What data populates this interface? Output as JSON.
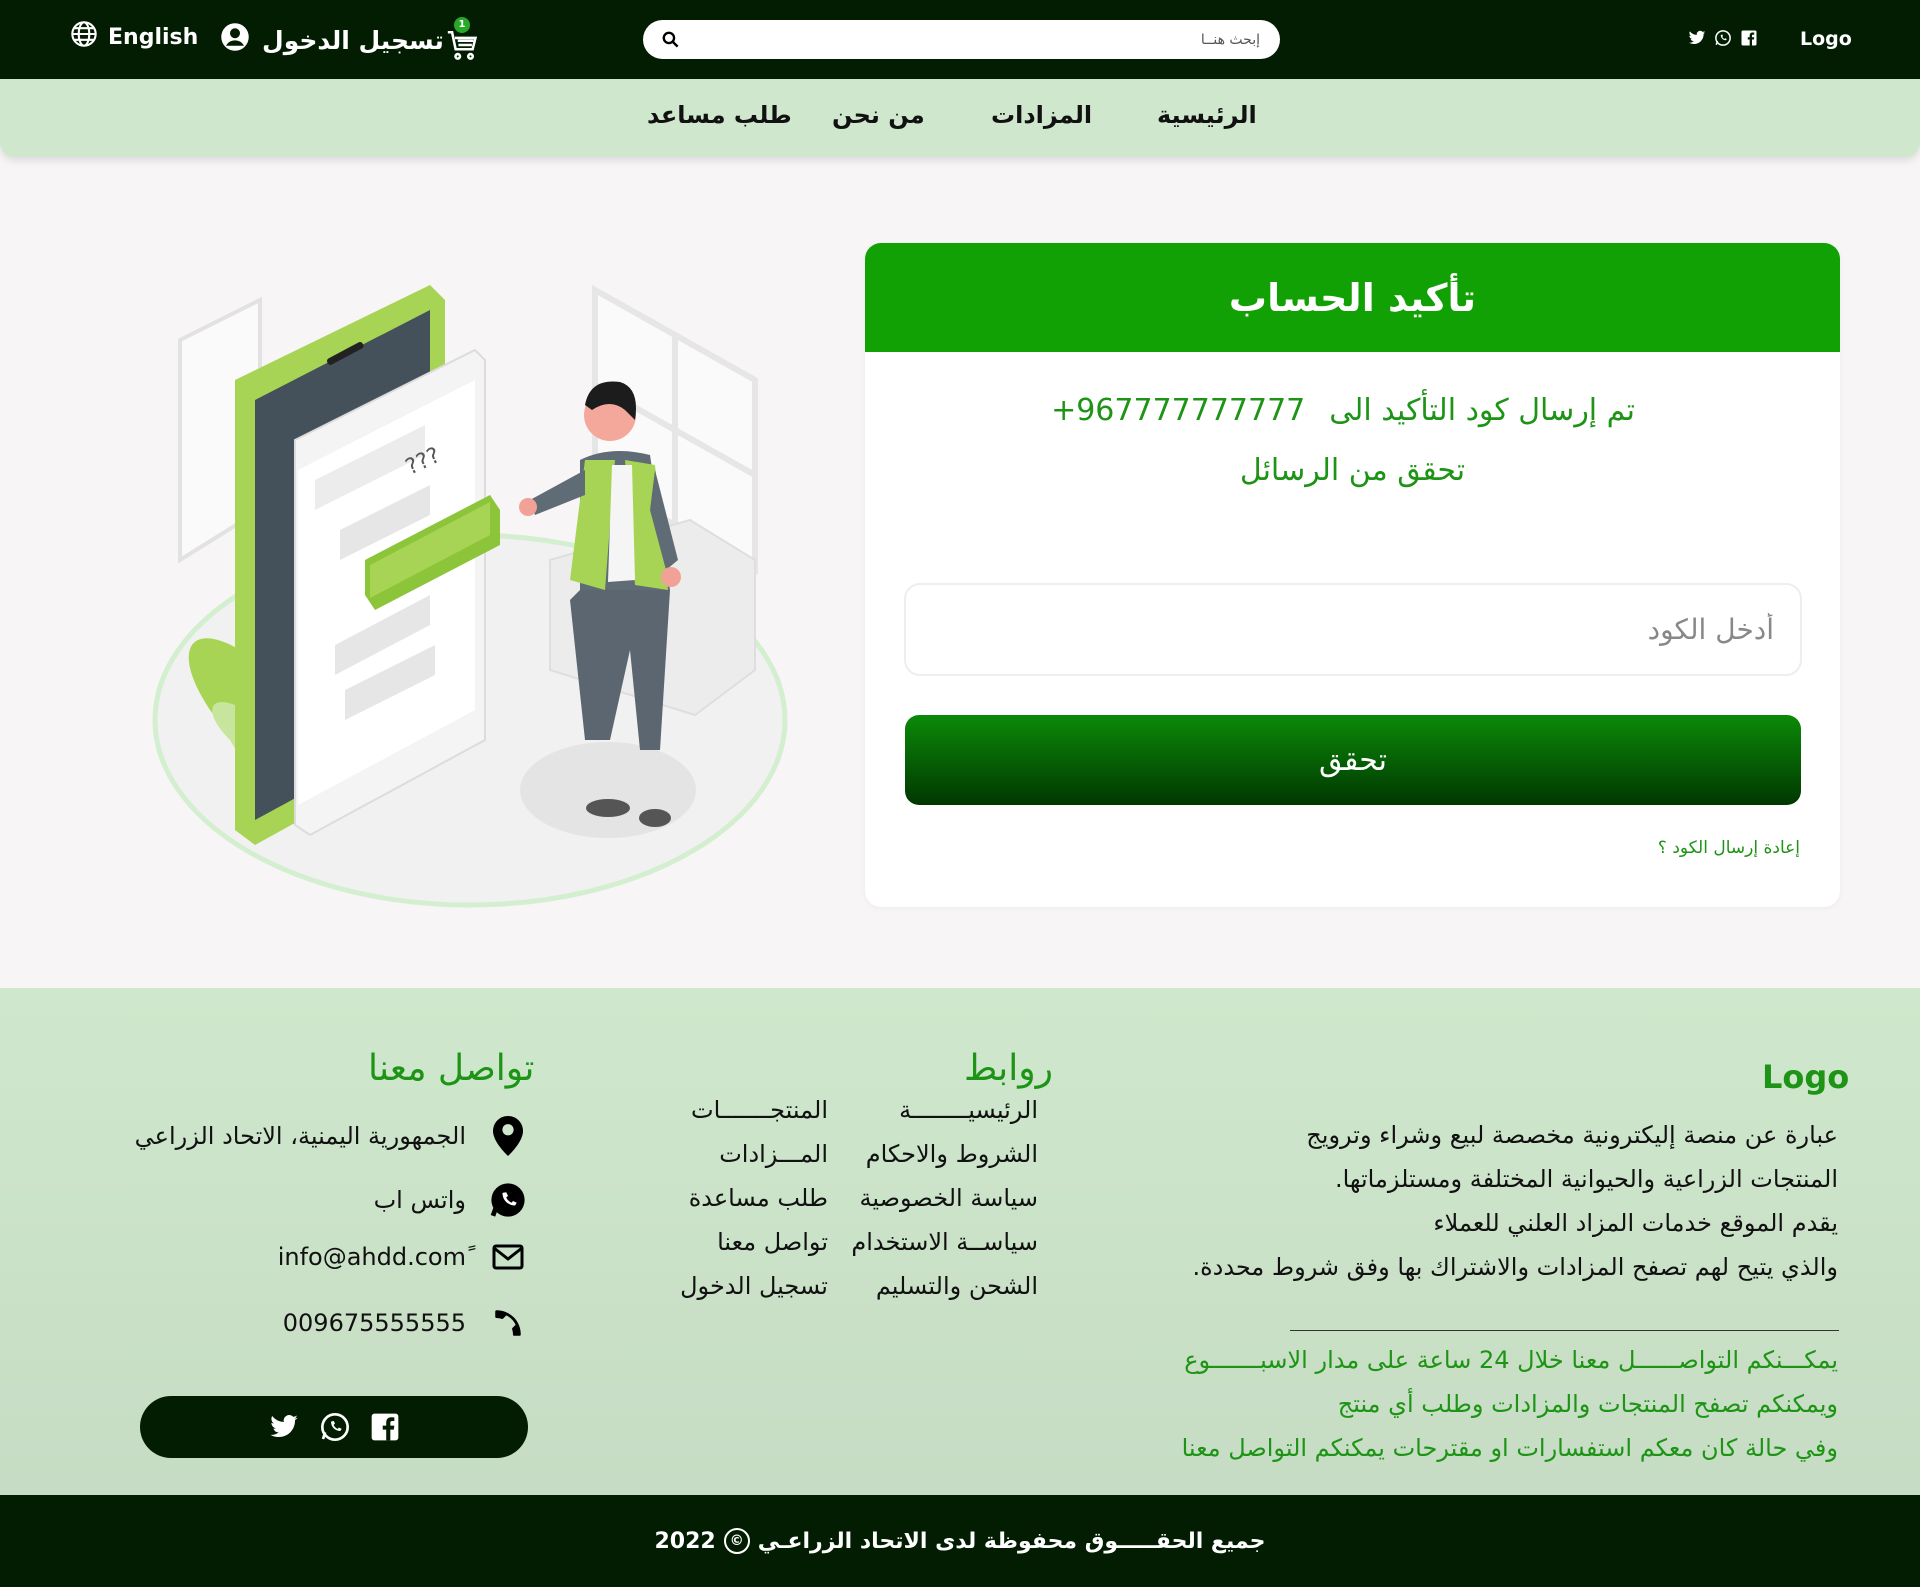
{
  "topbar": {
    "language_label": "English",
    "login_label": "تسجيل الدخول",
    "cart_count": "1",
    "search_placeholder": "إبحث هنــا",
    "logo": "Logo"
  },
  "nav": {
    "items": [
      "الرئيسية",
      "المزادات",
      "من نحن",
      "طلب مساعد"
    ]
  },
  "verify_card": {
    "title": "تأكيد الحساب",
    "sent_text": "تم إرسال كود التأكيد الى",
    "phone": "+967777777777",
    "check_text": "تحقق من الرسائل",
    "code_placeholder": "أدخل الكود",
    "verify_button": "تحقق",
    "resend_link": "إعادة إرسال الكود ؟"
  },
  "footer": {
    "logo": "Logo",
    "about_lines": [
      "عبارة عن منصة إليكترونية مخصصة لبيع وشراء وترويج",
      "المنتجات الزراعية والحيوانية المختلفة ومستلزماتها.",
      "يقدم الموقع خدمات المزاد العلني للعملاء",
      "والذي يتيح لهم تصفح المزادات والاشتراك بها وفق شروط محددة."
    ],
    "contact_info_lines": [
      "يمكـــنكم التواصــــــل معنا خلال 24 ساعة على مدار الاسبـــــــوع",
      "ويمكنكم تصفح المنتجات والمزادات وطلب أي منتج",
      "وفي حالة كان معكم استفسارات او مقترحات يمكنكم التواصل معنا"
    ],
    "links_title": "روابط",
    "links_col1": [
      "الرئيسيــــــــة",
      "الشروط والاحكام",
      "سياسة الخصوصية",
      "سياســة الاستخدام",
      "الشحن والتسليم"
    ],
    "links_col2": [
      "المنتجـــــــات",
      "المـــزادات",
      "طلب مساعدة",
      "تواصل معنا",
      "تسجيل الدخول"
    ],
    "contact_title": "تواصل معنا",
    "address": "الجمهورية اليمنية، الاتحاد الزراعي",
    "whatsapp": "واتس اب",
    "email": "info@ahdd.comً",
    "phone": "009675555555"
  },
  "copyright": {
    "text": "جميع الحقـــــوق محفوظة لدى الاتحاد الزراعـي",
    "symbol": "©",
    "year": "2022"
  },
  "colors": {
    "dark_green": "#021d02",
    "nav_green": "#cfe8cd",
    "header_green": "#12a104",
    "text_green": "#1e9416"
  },
  "icons": [
    "globe-icon",
    "user-icon",
    "cart-icon",
    "search-icon",
    "twitter-icon",
    "whatsapp-icon",
    "facebook-icon",
    "location-icon",
    "mail-icon",
    "phone-icon"
  ]
}
